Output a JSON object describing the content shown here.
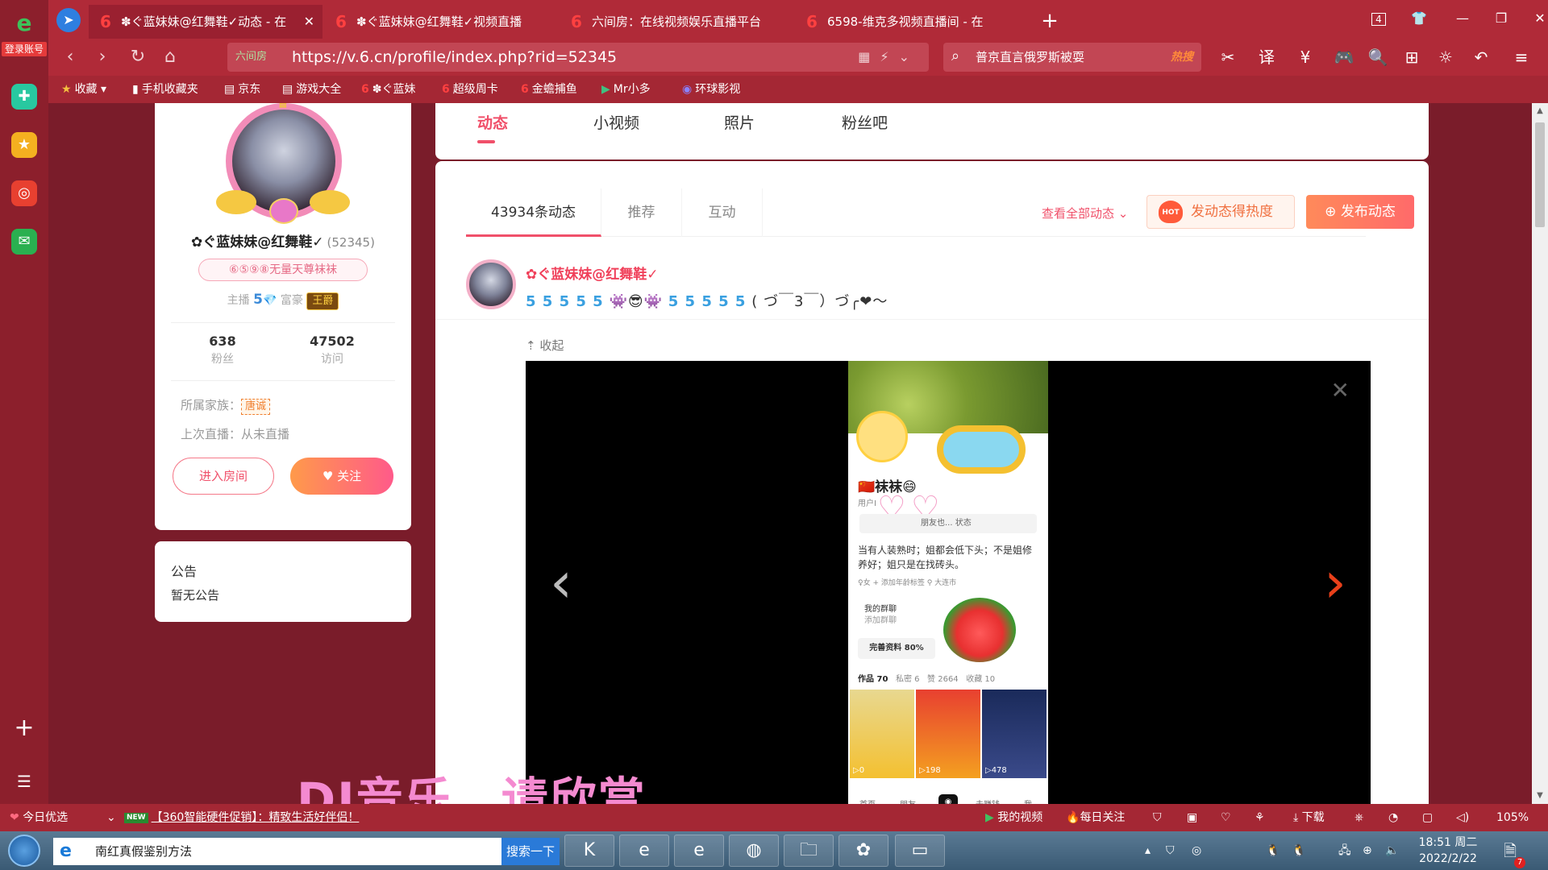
{
  "sidebar": {
    "login_label": "登录账号"
  },
  "tabs": [
    {
      "label": "✽ぐ蓝妹妹@红舞鞋✓动态 - 在",
      "active": true
    },
    {
      "label": "✽ぐ蓝妹妹@红舞鞋✓视频直播",
      "active": false
    },
    {
      "label": "六间房：在线视频娱乐直播平台",
      "active": false
    },
    {
      "label": "6598-维克多视频直播间 - 在",
      "active": false
    }
  ],
  "window": {
    "tab_count": "4"
  },
  "address": {
    "site_label": "六间房",
    "url": "https://v.6.cn/profile/index.php?rid=52345"
  },
  "search": {
    "query": "普京直言俄罗斯被耍",
    "hot_label": "热搜"
  },
  "bookmarks": [
    {
      "icon": "★",
      "label": "收藏"
    },
    {
      "icon": "▮",
      "label": "手机收藏夹"
    },
    {
      "icon": "▤",
      "label": "京东"
    },
    {
      "icon": "▤",
      "label": "游戏大全"
    },
    {
      "icon": "6",
      "label": "✽ぐ蓝妹"
    },
    {
      "icon": "6",
      "label": "超级周卡"
    },
    {
      "icon": "6",
      "label": "金蟾捕鱼"
    },
    {
      "icon": "▶",
      "label": "Mr小多"
    },
    {
      "icon": "◉",
      "label": "环球影视"
    }
  ],
  "profile": {
    "name": "✿ぐ蓝妹妹@红舞鞋✓",
    "rid": "(52345)",
    "badge": "⑥⑤⑨⑧无量天尊袜袜",
    "anchor_label": "主播",
    "anchor_level": "5",
    "rich_label": "富豪",
    "rich_badge": "王爵",
    "fans_count": "638",
    "fans_label": "粉丝",
    "visits_count": "47502",
    "visits_label": "访问",
    "family_label": "所属家族：",
    "family_tag": "唐诚",
    "last_live": "上次直播：从未直播",
    "enter_room_label": "进入房间",
    "follow_label": "关注"
  },
  "notice": {
    "title": "公告",
    "body": "暂无公告"
  },
  "page_tabs": [
    {
      "label": "动态",
      "active": true
    },
    {
      "label": "小视频",
      "active": false
    },
    {
      "label": "照片",
      "active": false
    },
    {
      "label": "粉丝吧",
      "active": false
    }
  ],
  "feed": {
    "tabs": [
      {
        "label": "43934条动态",
        "active": true
      },
      {
        "label": "推荐",
        "active": false
      },
      {
        "label": "互动",
        "active": false
      }
    ],
    "view_all_label": "查看全部动态",
    "hot_label": "发动态得热度",
    "hot_icon_text": "HOT",
    "publish_label": "发布动态"
  },
  "post": {
    "author": "✿ぐ蓝妹妹@红舞鞋✓",
    "text_prefix": "5 5 5 5 5",
    "text_middle": "5 5 5 5 5",
    "text_suffix": "( づ￣3￣）づ╭❤～",
    "collapse_label": "收起"
  },
  "phone": {
    "name": "🇨🇳袜袜😄",
    "user_id_prefix": "用户I",
    "friends_text": "朋友也... 状态",
    "bio": "当有人装熟时；姐都会低下头；不是姐修养好；姐只是在找砖头。",
    "tags": "♀女  + 添加年龄标签   ⚲ 大连市",
    "group_title": "我的群聊",
    "group_sub": "添加群聊",
    "complete_label": "完善资料 80%",
    "works_label": "作品 70",
    "private_label": "私密 6",
    "likes_label": "赞 2664",
    "fav_label": "收藏 10",
    "thumb_counts": [
      "▷0",
      "▷198",
      "▷478"
    ],
    "nav": [
      "首页",
      "朋友",
      "去赚钱",
      "我"
    ]
  },
  "overlay": {
    "text": "DJ音乐，请欣赏"
  },
  "status": {
    "daily_pick": "今日优选",
    "new_label": "NEW",
    "promo": "【360智能硬件促销】：精致生活好伴侣！",
    "my_video": "我的视频",
    "daily_follow": "每日关注",
    "download": "下载",
    "zoom": "105%"
  },
  "taskbar": {
    "search_query": "南红真假鉴别方法",
    "search_btn": "搜索一下",
    "time": "18:51 周二",
    "date": "2022/2/22",
    "notif_count": "7"
  }
}
